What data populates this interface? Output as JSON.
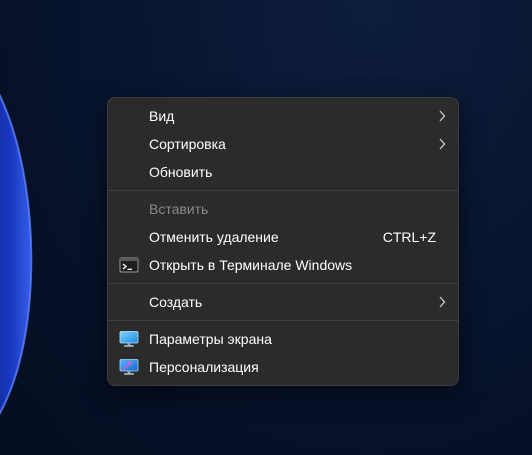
{
  "context_menu": {
    "items": [
      {
        "label": "Вид",
        "submenu": true
      },
      {
        "label": "Сортировка",
        "submenu": true
      },
      {
        "label": "Обновить"
      },
      {
        "label": "Вставить",
        "disabled": true
      },
      {
        "label": "Отменить удаление",
        "shortcut": "CTRL+Z"
      },
      {
        "label": "Открыть в Терминале Windows",
        "icon": "terminal-icon"
      },
      {
        "label": "Создать",
        "submenu": true
      },
      {
        "label": "Параметры экрана",
        "icon": "display-settings-icon"
      },
      {
        "label": "Персонализация",
        "icon": "personalization-icon"
      }
    ]
  },
  "colors": {
    "menu_bg": "#2b2b2b",
    "menu_border": "#3c3c3c",
    "text": "#ffffff",
    "text_disabled": "#8a8a8a",
    "separator": "#3f3f3f",
    "desktop_bg": "#081530"
  }
}
